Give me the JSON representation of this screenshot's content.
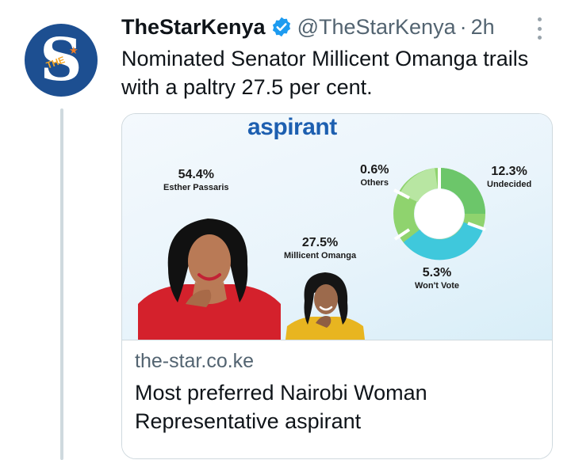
{
  "tweet": {
    "display_name": "TheStarKenya",
    "handle": "@TheStarKenya",
    "separator": "·",
    "time": "2h",
    "text": "Nominated Senator Millicent Omanga trails with a paltry 27.5 per cent.",
    "verified_icon": "verified-badge-icon",
    "more_icon": "more-options-icon"
  },
  "avatar": {
    "letter": "S",
    "tag": "THE",
    "brand_color": "#1d4f91"
  },
  "card": {
    "image": {
      "headline": "aspirant",
      "candidates": [
        {
          "pct": "54.4%",
          "name": "Esther Passaris"
        },
        {
          "pct": "27.5%",
          "name": "Millicent Omanga"
        }
      ],
      "donut_labels": [
        {
          "pct": "0.6%",
          "name": "Others"
        },
        {
          "pct": "12.3%",
          "name": "Undecided"
        },
        {
          "pct": "5.3%",
          "name": "Won't Vote"
        }
      ]
    },
    "domain": "the-star.co.ke",
    "title": "Most preferred Nairobi Woman Representative aspirant"
  },
  "colors": {
    "accent_blue": "#1d9bf0",
    "donut_green": "#6cc66a",
    "donut_cyan": "#3fc8dc"
  }
}
